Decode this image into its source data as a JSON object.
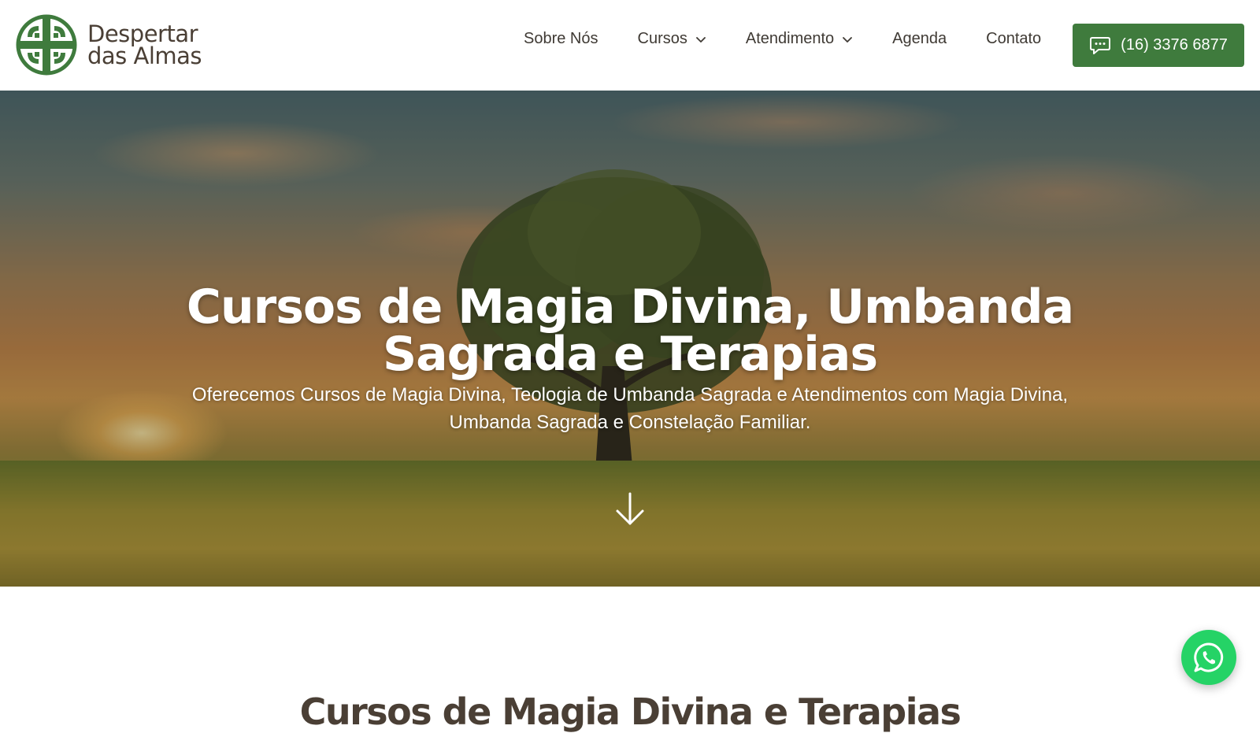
{
  "brand": {
    "name_line1": "Despertar",
    "name_line2": "das Almas",
    "logo_icon": "celtic-cross-logo-icon",
    "color": "#3f7b3d"
  },
  "nav": {
    "items": [
      {
        "label": "Sobre Nós",
        "has_dropdown": false
      },
      {
        "label": "Cursos",
        "has_dropdown": true
      },
      {
        "label": "Atendimento",
        "has_dropdown": true
      },
      {
        "label": "Agenda",
        "has_dropdown": false
      },
      {
        "label": "Contato",
        "has_dropdown": false
      }
    ],
    "phone_label": "(16) 3376 6877",
    "phone_icon": "chat-icon",
    "phone_button_color": "#3f7b3d"
  },
  "hero": {
    "title_line1": "Cursos de Magia Divina, Umbanda",
    "title_line2": "Sagrada e Terapias",
    "subtitle_line1": "Oferecemos Cursos de Magia Divina, Teologia de Umbanda Sagrada e Atendimentos com Magia Divina,",
    "subtitle_line2": "Umbanda Sagrada e Constelação Familiar.",
    "scroll_icon": "arrow-down-icon"
  },
  "section": {
    "title": "Cursos de Magia Divina e Terapias"
  },
  "floating": {
    "whatsapp_icon": "whatsapp-icon",
    "whatsapp_color": "#25d366"
  }
}
